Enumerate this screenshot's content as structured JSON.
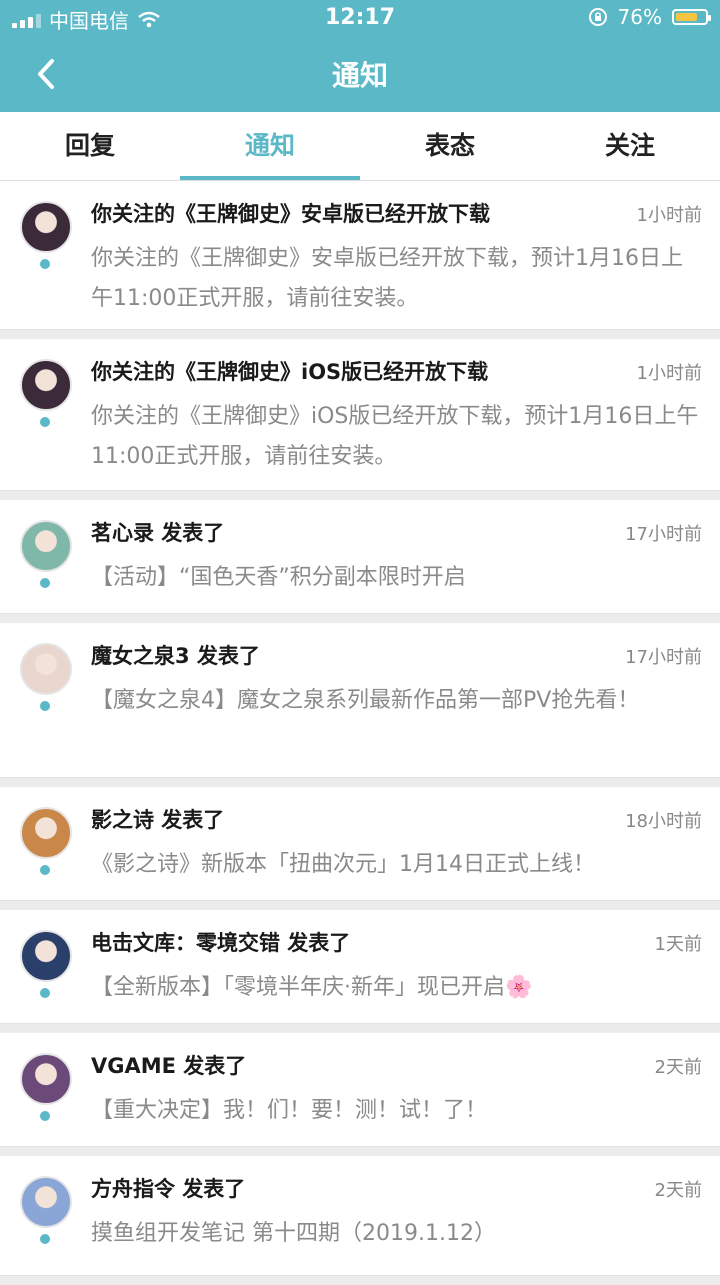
{
  "status_bar": {
    "carrier": "中国电信",
    "time": "12:17",
    "battery": "76%",
    "battery_level": 0.76
  },
  "nav": {
    "title": "通知",
    "back_icon": "chevron-left-icon"
  },
  "tabs": [
    {
      "label": "回复",
      "active": false
    },
    {
      "label": "通知",
      "active": true
    },
    {
      "label": "表态",
      "active": false
    },
    {
      "label": "关注",
      "active": false
    }
  ],
  "notifications": [
    {
      "title": "你关注的《王牌御史》安卓版已经开放下载",
      "time": "1小时前",
      "body": "你关注的《王牌御史》安卓版已经开放下载，预计1月16日上午11:00正式开服，请前往安装。",
      "avatar_color": "#3a2a3a"
    },
    {
      "title": "你关注的《王牌御史》iOS版已经开放下载",
      "time": "1小时前",
      "body": "你关注的《王牌御史》iOS版已经开放下载，预计1月16日上午11:00正式开服，请前往安装。",
      "avatar_color": "#3a2a3a"
    },
    {
      "title": "茗心录 发表了",
      "time": "17小时前",
      "body": "【活动】“国色天香”积分副本限时开启",
      "avatar_color": "#7fb7a8"
    },
    {
      "title": "魔女之泉3 发表了",
      "time": "17小时前",
      "body": "【魔女之泉4】魔女之泉系列最新作品第一部PV抢先看！",
      "avatar_color": "#e9d6cf"
    },
    {
      "title": "影之诗 发表了",
      "time": "18小时前",
      "body": "《影之诗》新版本「扭曲次元」1月14日正式上线！",
      "avatar_color": "#c9884a"
    },
    {
      "title": "电击文库：零境交错 发表了",
      "time": "1天前",
      "body": "【全新版本】「零境半年庆·新年」现已开启🌸",
      "avatar_color": "#2b3f6b"
    },
    {
      "title": "VGAME 发表了",
      "time": "2天前",
      "body": "【重大决定】我！们！要！测！试！了！",
      "avatar_color": "#6b4a7a"
    },
    {
      "title": "方舟指令 发表了",
      "time": "2天前",
      "body": "摸鱼组开发笔记 第十四期（2019.1.12）",
      "avatar_color": "#8aa6d6"
    }
  ]
}
